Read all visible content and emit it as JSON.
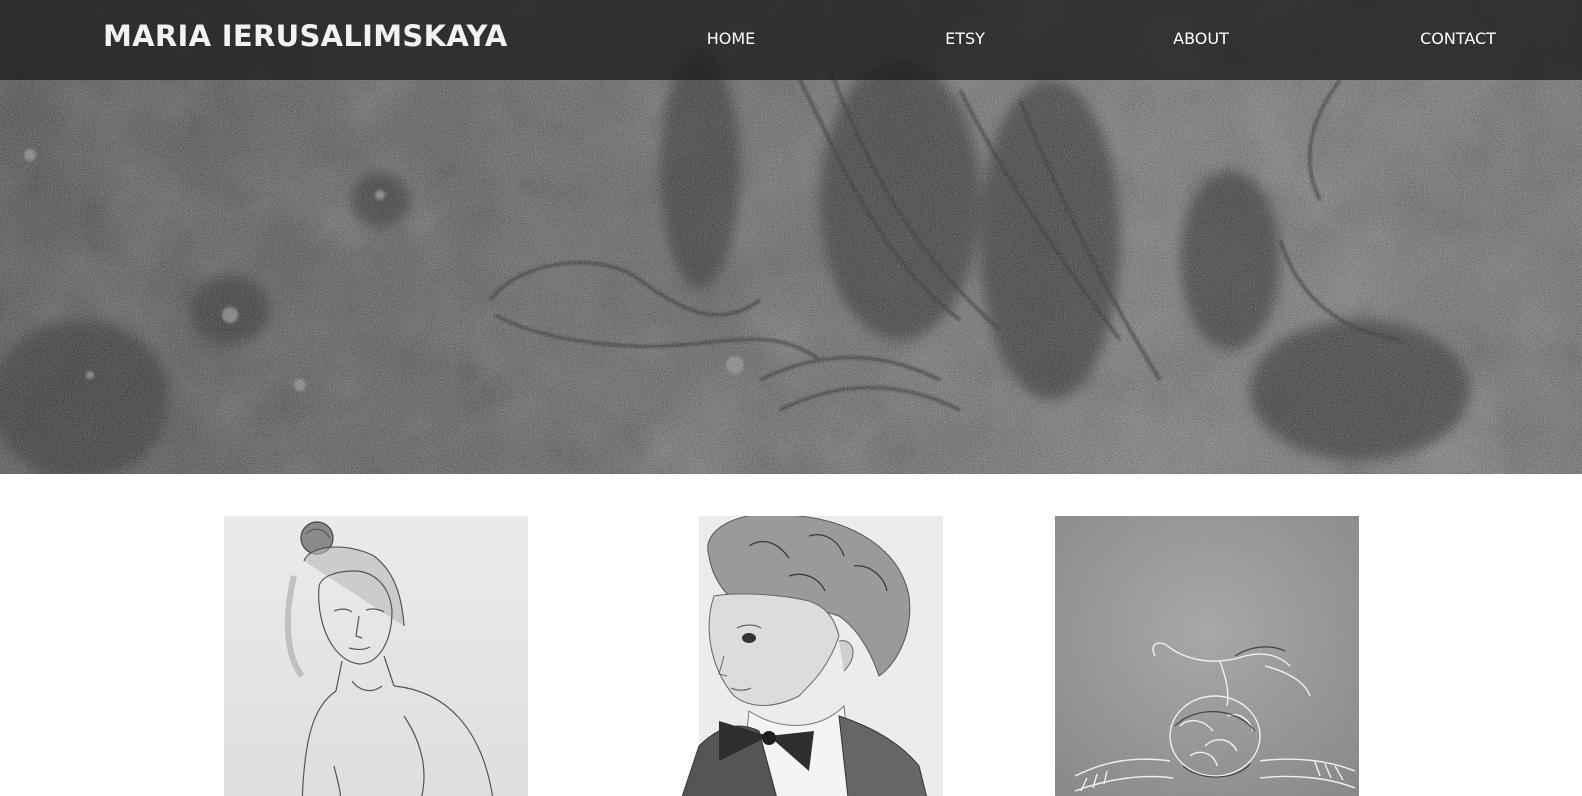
{
  "header": {
    "site_title": "MARIA IERUSALIMSKAYA",
    "nav": [
      {
        "label": "HOME"
      },
      {
        "label": "ETSY"
      },
      {
        "label": "ABOUT"
      },
      {
        "label": "CONTACT"
      }
    ]
  },
  "hero": {
    "image": "charcoal-drawing-banner"
  },
  "gallery": {
    "items": [
      {
        "image": "pencil-portrait-woman-with-hair-bun"
      },
      {
        "image": "pencil-portrait-boy-with-bow-tie"
      },
      {
        "image": "charcoal-drawing-figure-with-hands"
      }
    ]
  },
  "colors": {
    "header_bg": "#1c1c1c",
    "header_text": "#ffffff",
    "page_bg": "#ffffff"
  }
}
